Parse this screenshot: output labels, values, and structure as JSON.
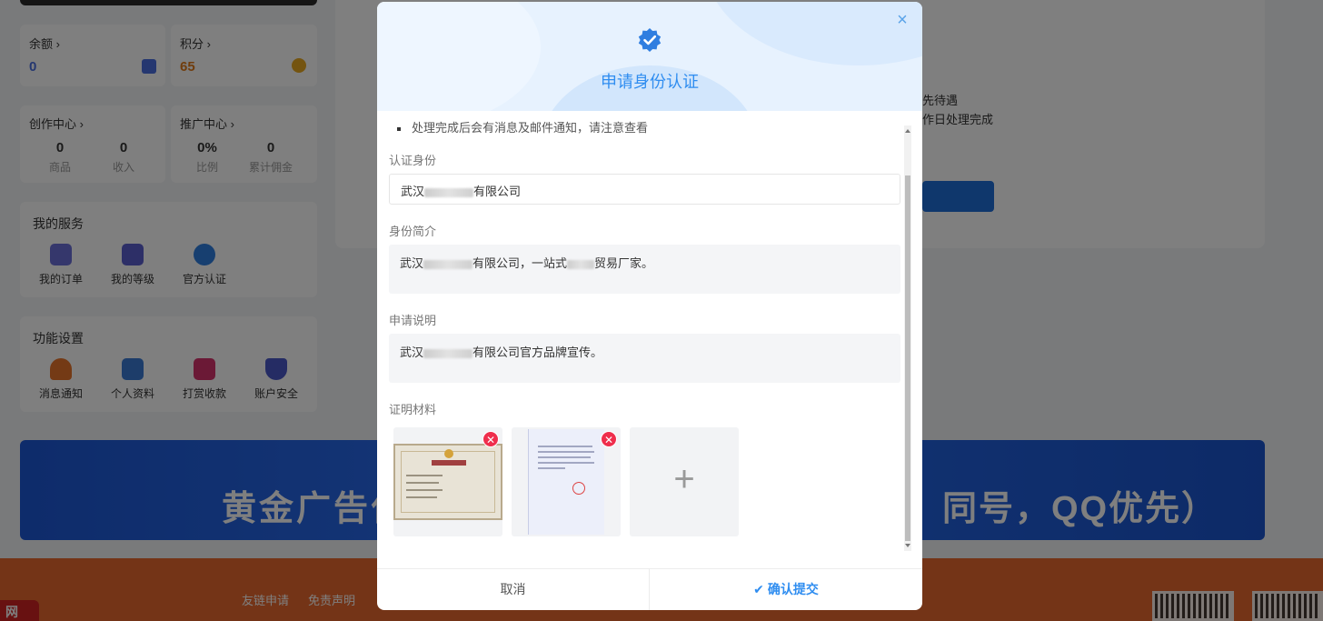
{
  "background": {
    "wallet": {
      "balance_label": "余额",
      "balance_value": "0",
      "points_label": "积分",
      "points_value": "65"
    },
    "creator": {
      "title": "创作中心",
      "items": [
        {
          "value": "0",
          "label": "商品"
        },
        {
          "value": "0",
          "label": "收入"
        }
      ]
    },
    "promo": {
      "title": "推广中心",
      "items": [
        {
          "value": "0%",
          "label": "比例"
        },
        {
          "value": "0",
          "label": "累计佣金"
        }
      ]
    },
    "my_services": {
      "title": "我的服务",
      "items": [
        "我的订单",
        "我的等级",
        "官方认证"
      ]
    },
    "settings": {
      "title": "功能设置",
      "items": [
        "消息通知",
        "个人资料",
        "打赏收款",
        "账户安全"
      ]
    },
    "right_panel": {
      "line1": "先待遇",
      "line2": "作日处理完成"
    },
    "ad": {
      "left_text": "黄金广告位",
      "right_text": "同号，QQ优先）"
    },
    "footer": {
      "links": [
        "友链申请",
        "免责声明"
      ],
      "logo": "网"
    }
  },
  "modal": {
    "title": "申请身份认证",
    "close": "×",
    "tip": "处理完成后会有消息及邮件通知，请注意查看",
    "identity_label": "认证身份",
    "identity_prefix": "武汉",
    "identity_suffix": "有限公司",
    "intro_label": "身份简介",
    "intro_prefix": "武汉",
    "intro_mid": "有限公司，一站式",
    "intro_suffix": "贸易厂家。",
    "desc_label": "申请说明",
    "desc_prefix": "武汉",
    "desc_suffix": "有限公司官方品牌宣传。",
    "proof_label": "证明材料",
    "add_label": "+",
    "cancel_label": "取消",
    "submit_label": "确认提交",
    "accent": "#2f8df0"
  }
}
